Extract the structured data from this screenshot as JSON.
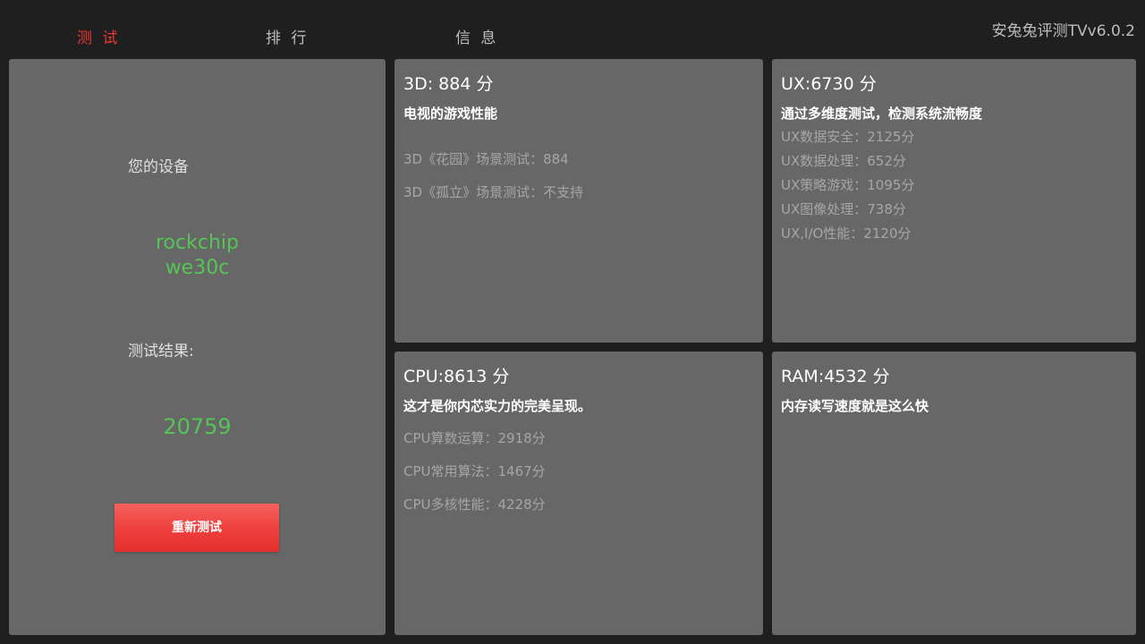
{
  "tabs": [
    {
      "label": "测 试",
      "active": true
    },
    {
      "label": "排 行",
      "active": false
    },
    {
      "label": "信 息",
      "active": false
    }
  ],
  "app_title": "安兔兔评测TVv6.0.2",
  "device_panel": {
    "your_device_label": "您的设备",
    "device_name_line1": "rockchip",
    "device_name_line2": "we30c",
    "result_label": "测试结果:",
    "total_score": "20759",
    "retest_button": "重新测试"
  },
  "scores": {
    "three_d": {
      "title": "3D: 884 分",
      "subtitle": "电视的游戏性能",
      "details": [
        "3D《花园》场景测试：884",
        "3D《孤立》场景测试：不支持"
      ]
    },
    "ux": {
      "title": "UX:6730 分",
      "subtitle": "通过多维度测试，检测系统流畅度",
      "details": [
        "UX数据安全：2125分",
        "UX数据处理：652分",
        "UX策略游戏：1095分",
        "UX图像处理：738分",
        "UX,I/O性能：2120分"
      ]
    },
    "cpu": {
      "title": "CPU:8613 分",
      "subtitle": "这才是你内芯实力的完美呈现。",
      "details": [
        "CPU算数运算：2918分",
        "CPU常用算法：1467分",
        "CPU多核性能：4228分"
      ]
    },
    "ram": {
      "title": "RAM:4532 分",
      "subtitle": "内存读写速度就是这么快",
      "details": []
    }
  },
  "colors": {
    "background": "#1f1f1f",
    "panel": "#676767",
    "active_tab": "#e53935",
    "score_green": "#56c456",
    "button_red": "#ee3f3c"
  }
}
